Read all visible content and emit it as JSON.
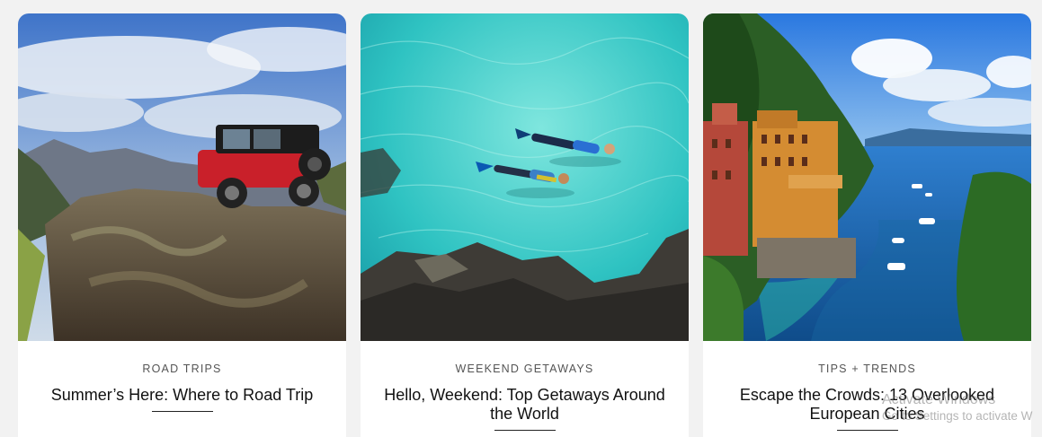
{
  "cards": [
    {
      "category": "ROAD TRIPS",
      "title": "Summer’s Here: Where to Road Trip",
      "image_alt": "Red jeep parked on a rocky mountain outcrop"
    },
    {
      "category": "WEEKEND GETAWAYS",
      "title": "Hello, Weekend: Top Getaways Around the World",
      "image_alt": "Two snorkelers swimming in clear turquoise water"
    },
    {
      "category": "TIPS + TRENDS",
      "title": "Escape the Crowds: 13 Overlooked European Cities",
      "image_alt": "Colorful coastal villa above a blue bay with boats"
    }
  ],
  "watermark": {
    "line1": "Activate Windows",
    "line2": "Go to Settings to activate W"
  },
  "colors": {
    "page_background": "#f2f2f2",
    "card_background": "#ffffff",
    "title_text": "#111111",
    "category_text": "#555555"
  }
}
